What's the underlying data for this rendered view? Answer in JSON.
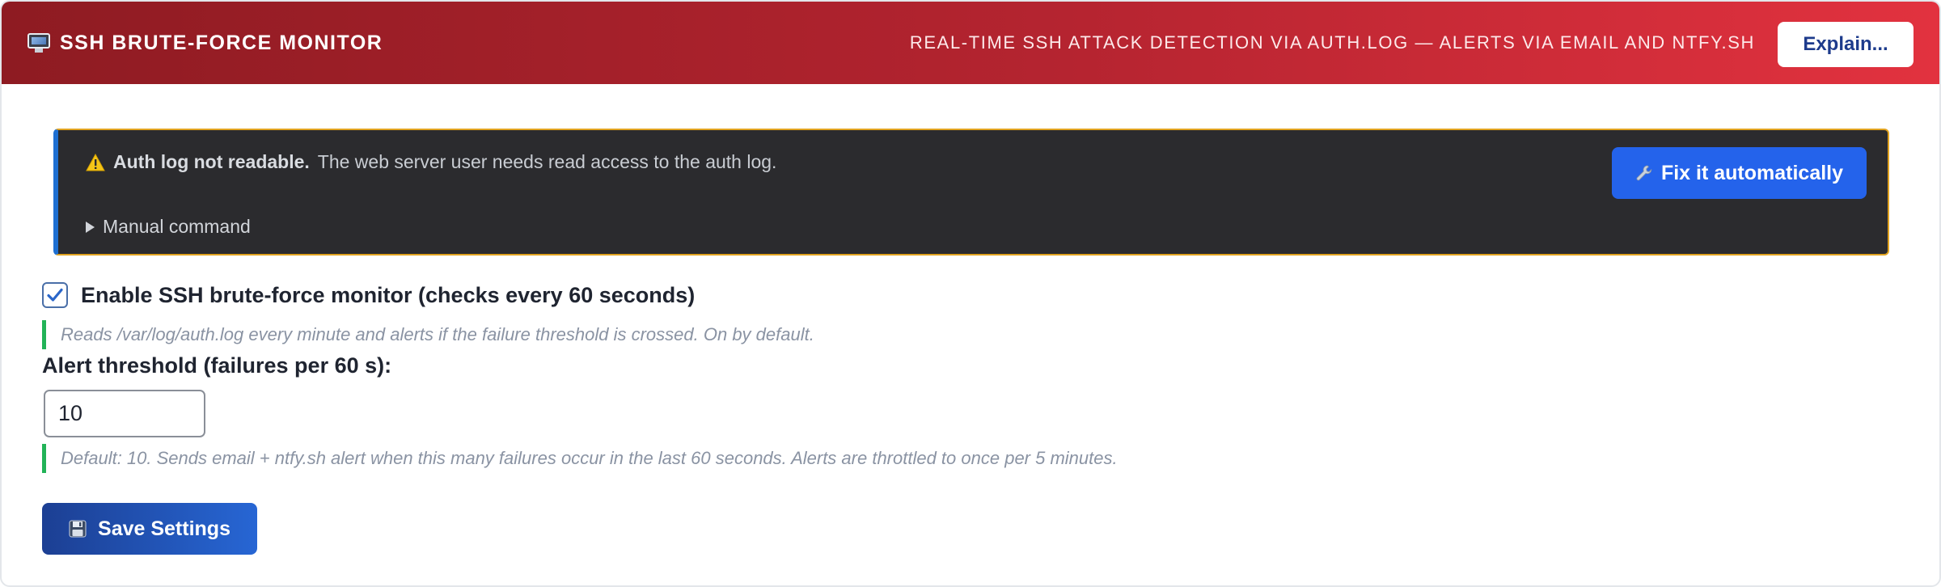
{
  "header": {
    "app_title": "SSH BRUTE-FORCE MONITOR",
    "app_icon": "monitor-icon",
    "subtitle": "REAL-TIME SSH ATTACK DETECTION VIA AUTH.LOG — ALERTS VIA EMAIL AND NTFY.SH",
    "explain_label": "Explain..."
  },
  "alert": {
    "icon": "warning-icon",
    "title": "Auth log not readable.",
    "message": "The web server user needs read access to the auth log.",
    "manual_command_label": "Manual command",
    "fix_icon": "wrench-icon",
    "fix_label": "Fix it automatically"
  },
  "settings": {
    "enable_checked": true,
    "enable_label": "Enable SSH brute-force monitor (checks every 60 seconds)",
    "enable_hint": "Reads /var/log/auth.log every minute and alerts if the failure threshold is crossed. On by default.",
    "threshold_label": "Alert threshold (failures per 60 s):",
    "threshold_value": "10",
    "threshold_hint": "Default: 10. Sends email + ntfy.sh alert when this many failures occur in the last 60 seconds. Alerts are throttled to once per 5 minutes.",
    "save_icon": "floppy-disk-icon",
    "save_label": "Save Settings"
  },
  "colors": {
    "header_start": "#8e1b22",
    "header_end": "#e2323f",
    "alert_border": "#e0a21f",
    "accent_blue": "#2463eb",
    "hint_bar": "#22b357"
  }
}
